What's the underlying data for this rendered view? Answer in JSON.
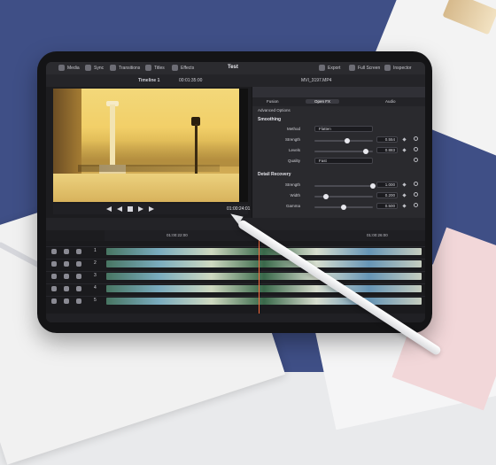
{
  "topbar": {
    "items": [
      "Media",
      "Sync",
      "Transitions",
      "Titles",
      "Effects"
    ],
    "title": "Test",
    "right_items": [
      "Export",
      "Full Screen",
      "Inspector"
    ]
  },
  "subbar": {
    "timeline_name": "Timeline 1",
    "timecode": "00:01:35:00",
    "clip_name": "MVI_3197.MP4"
  },
  "inspector": {
    "tabs": [
      "Fusion",
      "Open FX",
      "Audio"
    ],
    "advanced_options": "Advanced Options",
    "smoothing": {
      "section": "Smoothing",
      "method_label": "Method",
      "method_value": "Flatten",
      "strength_label": "Strength",
      "strength_value": "0.554",
      "strength_fraction": 0.554,
      "levels_label": "Levels",
      "levels_value": "0.883",
      "levels_fraction": 0.883,
      "quality_label": "Quality",
      "quality_value": "Fast"
    },
    "detail_recovery": {
      "section": "Detail Recovery",
      "strength_label": "Strength",
      "strength_value": "1.000",
      "strength_fraction": 1.0,
      "width_label": "Width",
      "width_value": "0.200",
      "width_fraction": 0.2,
      "gamma_label": "Gamma",
      "gamma_value": "0.500",
      "gamma_fraction": 0.5
    }
  },
  "viewer": {
    "timecode": "01:00:24:01"
  },
  "timeline": {
    "ruler_labels": [
      "01:00:22:00",
      "01:00:26:00"
    ],
    "track_numbers": [
      "1",
      "2",
      "3",
      "4",
      "5"
    ]
  }
}
